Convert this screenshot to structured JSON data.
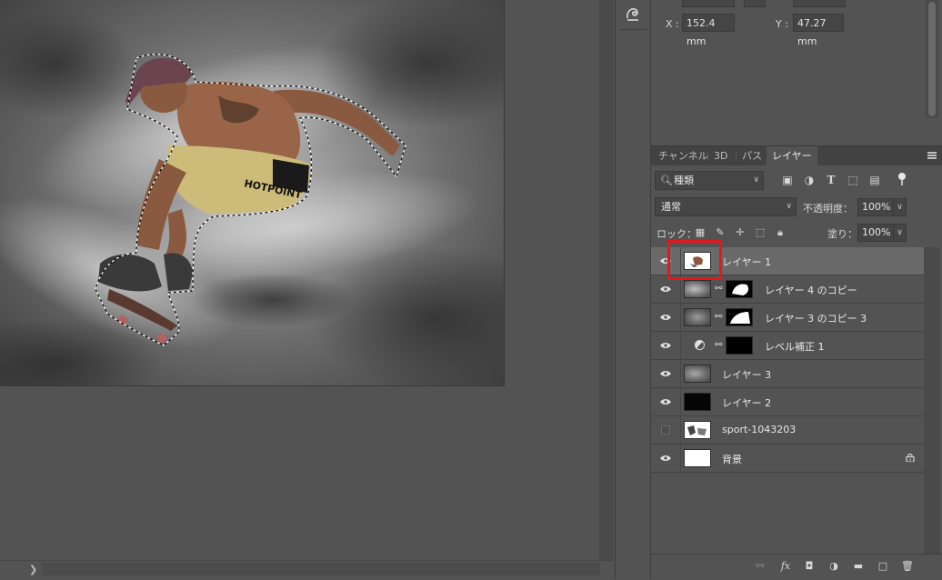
{
  "properties": {
    "x_label": "X :",
    "x_value": "152.4 mm",
    "y_label": "Y :",
    "y_value": "47.27 mm"
  },
  "tabs": [
    {
      "label": "チャンネル",
      "active": false
    },
    {
      "label": "3D",
      "active": false
    },
    {
      "label": "パス",
      "active": false
    },
    {
      "label": "レイヤー",
      "active": true
    }
  ],
  "filter": {
    "kind_label": "種類",
    "search_icon": "search-icon",
    "icons": [
      "pixel-filter-icon",
      "adjustment-filter-icon",
      "type-filter-icon",
      "shape-filter-icon",
      "smart-object-filter-icon"
    ]
  },
  "blend": {
    "mode": "通常",
    "opacity_label": "不透明度：",
    "opacity_value": "100%"
  },
  "lock": {
    "label": "ロック：",
    "fill_label": "塗り：",
    "fill_value": "100%"
  },
  "layers": [
    {
      "name": "レイヤー 1",
      "visible": true,
      "selected": true,
      "thumb": "photo-cutout"
    },
    {
      "name": "レイヤー 4 のコピー",
      "visible": true,
      "selected": false,
      "thumb": "clouds",
      "mask": true
    },
    {
      "name": "レイヤー 3 のコピー 3",
      "visible": true,
      "selected": false,
      "thumb": "clouds",
      "mask": true
    },
    {
      "name": "レベル補正 1",
      "visible": true,
      "selected": false,
      "thumb": "adjustment",
      "mask": true
    },
    {
      "name": "レイヤー 3",
      "visible": true,
      "selected": false,
      "thumb": "clouds"
    },
    {
      "name": "レイヤー 2",
      "visible": true,
      "selected": false,
      "thumb": "black"
    },
    {
      "name": "sport-1043203",
      "visible": false,
      "selected": false,
      "thumb": "photo"
    },
    {
      "name": "背景",
      "visible": true,
      "selected": false,
      "thumb": "white",
      "locked": true
    }
  ],
  "colors": {
    "panel_bg": "#535353",
    "selected_row": "#6a6a6a",
    "highlight": "#e5161e"
  }
}
